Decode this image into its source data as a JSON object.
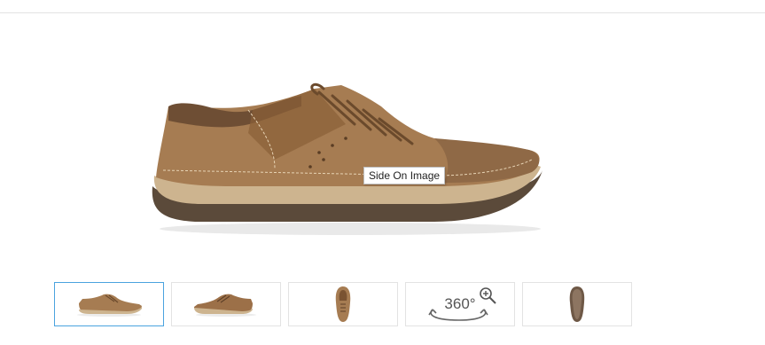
{
  "main_image": {
    "alt_tooltip": "Side On Image"
  },
  "thumbnails": [
    {
      "name": "side-view",
      "selected": true
    },
    {
      "name": "angled-view",
      "selected": false
    },
    {
      "name": "top-view",
      "selected": false
    },
    {
      "name": "360-view",
      "label": "360°",
      "icon": "zoom-in-icon",
      "selected": false
    },
    {
      "name": "sole-view",
      "selected": false
    }
  ],
  "colors": {
    "selected_border": "#4aa3df",
    "thumb_border": "#e3e3e3",
    "leather": "#a67c52"
  }
}
